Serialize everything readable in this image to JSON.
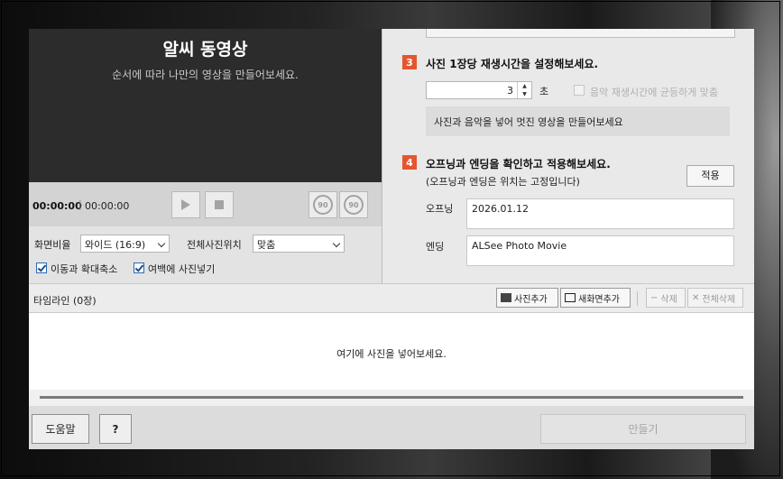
{
  "preview": {
    "title": "알씨 동영상",
    "subtitle": "순서에 따라 나만의 영상을 만들어보세요.",
    "time_current": "00:00:00",
    "time_total": "00:00:00",
    "rotate_left_label": "90",
    "rotate_right_label": "90"
  },
  "options": {
    "aspect_label": "화면비율",
    "aspect_value": "와이드 (16:9)",
    "position_label": "전체사진위치",
    "position_value": "맞춤",
    "move_zoom_label": "이동과 확대축소",
    "fill_blank_label": "여백에 사진넣기"
  },
  "step3": {
    "number": "3",
    "title": "사진 1장당 재생시간을 설정해보세요.",
    "seconds_value": "3",
    "unit": "초",
    "equal_label": "음악 재생시간에 균등하게 맞춤",
    "info": "사진과 음악을 넣어 멋진 영상을 만들어보세요"
  },
  "step4": {
    "number": "4",
    "title": "오프닝과 엔딩을 확인하고 적용해보세요.",
    "note": "(오프닝과 엔딩은 위치는 고정입니다)",
    "apply_label": "적용",
    "opening_label": "오프닝",
    "opening_value": "2026.01.12",
    "ending_label": "엔딩",
    "ending_value": "ALSee Photo Movie"
  },
  "timeline": {
    "title": "타임라인 (0장)",
    "add_photo": "사진추가",
    "add_new_screen": "새화면추가",
    "delete": "삭제",
    "delete_all": "전체삭제",
    "drop_hint": "여기에 사진을 넣어보세요."
  },
  "footer": {
    "help": "도움말",
    "question": "?",
    "make": "만들기"
  }
}
